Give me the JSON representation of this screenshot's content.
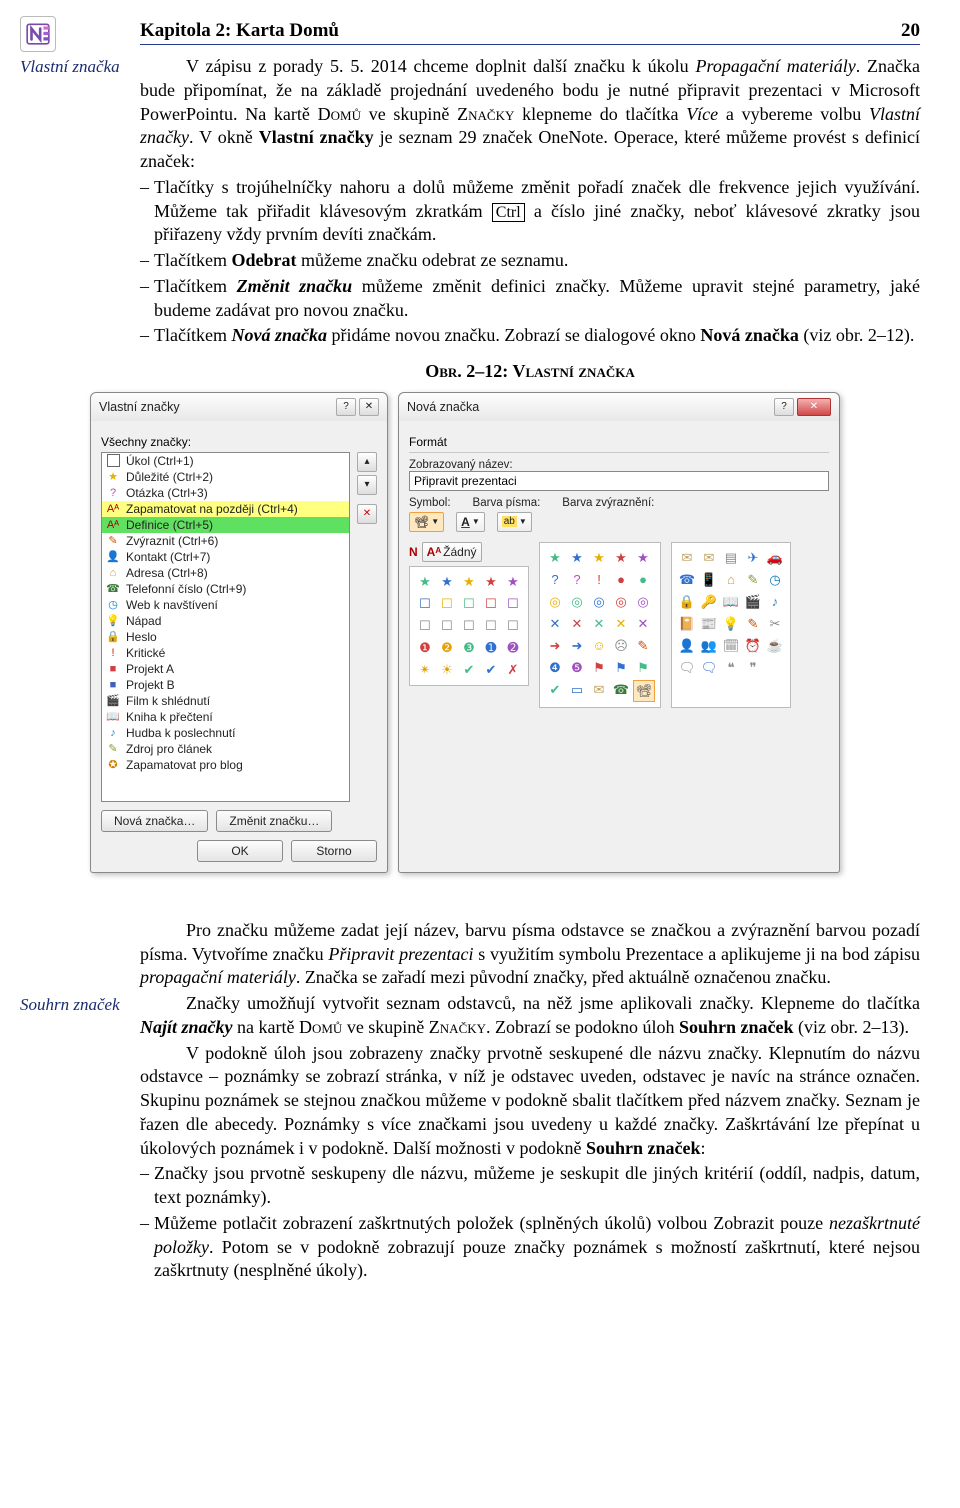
{
  "header": {
    "title": "Kapitola 2: Karta Domů",
    "page": "20"
  },
  "marginLabels": {
    "top": "Vlastní značka",
    "bottom": "Souhrn značek"
  },
  "para1": {
    "lead": "V zápisu z porady 5. 5. 2014 chceme doplnit další značku k úkolu ",
    "i1": "Propagační materiály",
    "s2": ". Značka bude připomínat, že na základě projednání uvedeného bodu je nutné připravit prezentaci v Microsoft PowerPointu. Na kartě ",
    "sc1": "Domů",
    "s3": " ve skupině ",
    "sc2": "Značky",
    "s4": " klepneme do tlačítka ",
    "i2": "Více",
    "s5": " a vybereme volbu ",
    "i3": "Vlastní značky",
    "s6": ". V okně ",
    "b1": "Vlastní značky",
    "s7": " je seznam 29 značek OneNote. Operace, které můžeme provést s definicí značek:"
  },
  "bullets1": {
    "b1a": "Tlačítky s trojúhelníčky nahoru a dolů můžeme změnit pořadí značek dle frekvence jejich využívání. Můžeme tak přiřadit klávesovým zkratkám ",
    "b1key": "Ctrl",
    "b1b": " a číslo jiné značky, neboť klávesové zkratky jsou přiřazeny vždy prvním devíti značkám.",
    "b2a": "Tlačítkem ",
    "b2b": "Odebrat",
    "b2c": " můžeme značku odebrat ze seznamu.",
    "b3a": "Tlačítkem ",
    "b3b": "Změnit značku",
    "b3c": " můžeme změnit definici značky. Můžeme upravit stejné parametry, jaké budeme zadávat pro novou značku.",
    "b4a": "Tlačítkem ",
    "b4b": "Nová značka",
    "b4c": " přidáme novou značku. Zobrazí se dialogové okno ",
    "b4d": "Nová značka",
    "b4e": " (viz obr. 2–12)."
  },
  "figCaption": "Obr. 2–12: Vlastní značka",
  "dlg1": {
    "title": "Vlastní značky",
    "label": "Všechny značky:",
    "items": [
      {
        "icon": "☐",
        "color": "#3b6fb5",
        "text": "Úkol (Ctrl+1)",
        "hl": ""
      },
      {
        "icon": "★",
        "color": "#e8b000",
        "text": "Důležité (Ctrl+2)",
        "hl": ""
      },
      {
        "icon": "?",
        "color": "#c04ac0",
        "text": "Otázka (Ctrl+3)",
        "hl": ""
      },
      {
        "icon": "Aᴬ",
        "color": "#b00000",
        "text": "Zapamatovat na později (Ctrl+4)",
        "hl": "hl-yellow"
      },
      {
        "icon": "Aᴬ",
        "color": "#b00000",
        "text": "Definice (Ctrl+5)",
        "hl": "hl-green"
      },
      {
        "icon": "✎",
        "color": "#d05000",
        "text": "Zvýraznit (Ctrl+6)",
        "hl": ""
      },
      {
        "icon": "👤",
        "color": "#888",
        "text": "Kontakt (Ctrl+7)",
        "hl": ""
      },
      {
        "icon": "⌂",
        "color": "#c49a40",
        "text": "Adresa (Ctrl+8)",
        "hl": ""
      },
      {
        "icon": "☎",
        "color": "#3a7a3a",
        "text": "Telefonní číslo (Ctrl+9)",
        "hl": ""
      },
      {
        "icon": "◷",
        "color": "#0a7ab5",
        "text": "Web k navštívení",
        "hl": ""
      },
      {
        "icon": "💡",
        "color": "#e0b020",
        "text": "Nápad",
        "hl": ""
      },
      {
        "icon": "🔒",
        "color": "#c08020",
        "text": "Heslo",
        "hl": ""
      },
      {
        "icon": "!",
        "color": "#d02000",
        "text": "Kritické",
        "hl": ""
      },
      {
        "icon": "■",
        "color": "#d04040",
        "text": "Projekt A",
        "hl": ""
      },
      {
        "icon": "■",
        "color": "#4060c0",
        "text": "Projekt B",
        "hl": ""
      },
      {
        "icon": "🎬",
        "color": "#666",
        "text": "Film k shlédnutí",
        "hl": ""
      },
      {
        "icon": "📖",
        "color": "#a07040",
        "text": "Kniha k přečtení",
        "hl": ""
      },
      {
        "icon": "♪",
        "color": "#4080c0",
        "text": "Hudba k poslechnutí",
        "hl": ""
      },
      {
        "icon": "✎",
        "color": "#80a030",
        "text": "Zdroj pro článek",
        "hl": ""
      },
      {
        "icon": "✪",
        "color": "#d08000",
        "text": "Zapamatovat pro blog",
        "hl": ""
      }
    ],
    "btnNew": "Nová značka…",
    "btnEdit": "Změnit značku…",
    "ok": "OK",
    "cancel": "Storno"
  },
  "dlg2": {
    "title": "Nová značka",
    "section": "Formát",
    "nameLabel": "Zobrazovaný název:",
    "nameValue": "Připravit prezentaci",
    "colSymbol": "Symbol:",
    "colFont": "Barva písma:",
    "colHighlight": "Barva zvýraznění:",
    "none": "Žádný"
  },
  "para2": {
    "s1": "Pro značku můžeme zadat její název, barvu písma odstavce se značkou a zvýraznění barvou pozadí písma. Vytvoříme značku ",
    "i1": "Připravit prezentaci",
    "s2": " s využitím symbolu Prezentace a aplikujeme ji na bod zápisu ",
    "i2": "propagační materiály",
    "s3": ". Značka se zařadí mezi původní značky, před aktuálně označenou značku."
  },
  "para3": {
    "s1": "Značky umožňují vytvořit seznam odstavců, na něž jsme aplikovali značky. Klepneme do tlačítka ",
    "bi1": "Najít značky",
    "s2": " na kartě ",
    "sc1": "Domů",
    "s3": " ve skupině ",
    "sc2": "Značky",
    "s4": ". Zobrazí se podokno úloh ",
    "b1": "Souhrn značek",
    "s5": " (viz obr. 2–13)."
  },
  "para4": {
    "s1": "V podokně úloh jsou zobrazeny značky prvotně seskupené dle názvu značky. Klepnutím do názvu odstavce – poznámky se zobrazí stránka, v níž je odstavec uveden, odstavec je navíc na stránce označen. Skupinu poznámek se stejnou značkou můžeme v podokně sbalit tlačítkem před názvem značky. Seznam je řazen dle abecedy. Poznámky s více značkami jsou uvedeny u každé značky. Zaškrtávání lze přepínat u úkolových poznámek i v podokně. Další možnosti v podokně ",
    "b1": "Souhrn značek",
    "s2": ":"
  },
  "bullets2": {
    "b1": "Značky jsou prvotně seskupeny dle názvu, můžeme je seskupit dle jiných kritérií (oddíl, nadpis, datum, text poznámky).",
    "b2a": "Můžeme potlačit zobrazení zaškrtnutých položek (splněných úkolů) volbou Zobrazit pouze ",
    "b2i": "nezaškrtnuté položky",
    "b2b": ". Potom se v podokně zobrazují pouze značky poznámek s možností zaškrtnutí, které nejsou zaškrtnuty (nesplněné úkoly)."
  }
}
